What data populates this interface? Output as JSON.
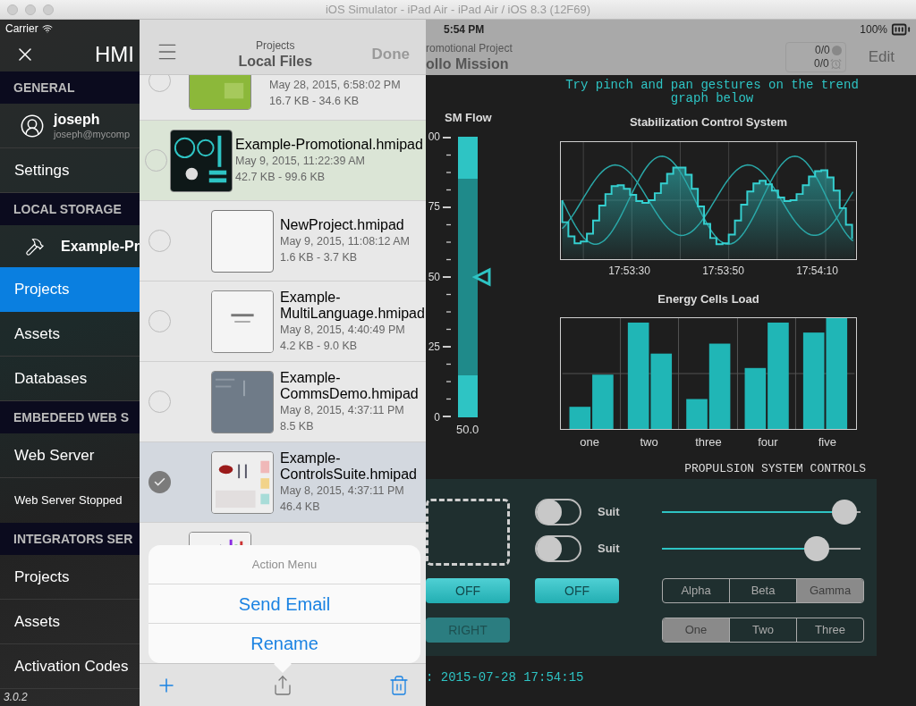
{
  "simulator": {
    "title": "iOS Simulator - iPad Air - iPad Air / iOS 8.3 (12F69)"
  },
  "status_bar": {
    "carrier": "Carrier",
    "time": "5:54 PM",
    "battery": "100%"
  },
  "sidebar": {
    "title": "HMI",
    "items": [
      {
        "kind": "section",
        "label": "GENERAL"
      },
      {
        "kind": "user",
        "name": "joseph",
        "email": "joseph@mycomp"
      },
      {
        "kind": "item",
        "label": "Settings",
        "selected": false
      },
      {
        "kind": "section",
        "label": "LOCAL STORAGE"
      },
      {
        "kind": "project",
        "label": "Example-Pr"
      },
      {
        "kind": "item",
        "label": "Projects",
        "selected": true
      },
      {
        "kind": "item",
        "label": "Assets",
        "selected": false
      },
      {
        "kind": "item",
        "label": "Databases",
        "selected": false
      },
      {
        "kind": "section",
        "label": "EMBEDEED WEB S"
      },
      {
        "kind": "item",
        "label": "Web Server",
        "selected": false
      },
      {
        "kind": "note",
        "label": "Web Server Stopped"
      },
      {
        "kind": "section",
        "label": "INTEGRATORS SER"
      },
      {
        "kind": "item",
        "label": "Projects",
        "selected": false
      },
      {
        "kind": "item",
        "label": "Assets",
        "selected": false
      },
      {
        "kind": "item",
        "label": "Activation Codes",
        "selected": false
      }
    ],
    "version": "3.0.2"
  },
  "file_browser": {
    "subtitle": "Projects",
    "title": "Local Files",
    "done": "Done",
    "files": [
      {
        "kind": "partial",
        "date": "May 28, 2015, 6:58:02 PM",
        "size": "16.7 KB - 34.6 KB",
        "checked": false,
        "current": false
      },
      {
        "kind": "file",
        "name": "Example-Promotional.hmipad",
        "date": "May 9, 2015, 11:22:39 AM",
        "size": "42.7 KB - 99.6 KB",
        "checked": false,
        "current": true
      },
      {
        "kind": "file",
        "name": "NewProject.hmipad",
        "date": "May 9, 2015, 11:08:12 AM",
        "size": "1.6 KB - 3.7 KB",
        "checked": false,
        "current": false
      },
      {
        "kind": "file",
        "name": "Example-\nMultiLanguage.hmipad",
        "date": "May 8, 2015, 4:40:49 PM",
        "size": "4.2 KB - 9.0 KB",
        "checked": false,
        "current": false
      },
      {
        "kind": "file",
        "name": "Example-\nCommsDemo.hmipad",
        "date": "May 8, 2015, 4:37:11 PM",
        "size": "8.5 KB",
        "checked": false,
        "current": false
      },
      {
        "kind": "file",
        "name": "Example-\nControlsSuite.hmipad",
        "date": "May 8, 2015, 4:37:11 PM",
        "size": "46.4 KB",
        "checked": true,
        "current": false
      },
      {
        "kind": "thumbnail_only"
      }
    ],
    "action_menu": {
      "title": "Action Menu",
      "actions": [
        "Send Email",
        "Rename"
      ]
    }
  },
  "dashboard": {
    "project_subtitle": "romotional Project",
    "project_title": "ollo Mission",
    "alarms": [
      "0/0",
      "0/0"
    ],
    "edit": "Edit",
    "hint": "Try pinch and pan gestures on the trend graph below",
    "gauge": {
      "title": "SM Flow",
      "ticks": [
        "00",
        "75",
        "50",
        "25",
        "0"
      ],
      "level": 0.5,
      "value": "50.0"
    },
    "trend": {
      "title": "Stabilization Control System",
      "time_labels": [
        "17:53:30",
        "17:53:50",
        "17:54:10"
      ]
    },
    "energy": {
      "title": "Energy Cells Load",
      "categories": [
        "one",
        "two",
        "three",
        "four",
        "five"
      ]
    },
    "controls": {
      "title": "PROPULSION SYSTEM CONTROLS",
      "buttons": [
        {
          "label": "OFF",
          "disabled": false
        },
        {
          "label": "RIGHT",
          "disabled": true
        },
        {
          "label": "OFF",
          "disabled": false
        }
      ],
      "switches": [
        {
          "label": "Suit",
          "on": false
        },
        {
          "label": "Suit",
          "on": false
        }
      ],
      "sliders": [
        {
          "level": 0.92
        },
        {
          "level": 0.78
        }
      ],
      "segments": [
        [
          {
            "label": "Alpha",
            "selected": false
          },
          {
            "label": "Beta",
            "selected": false
          },
          {
            "label": "Gamma",
            "selected": true
          }
        ],
        [
          {
            "label": "One",
            "selected": true
          },
          {
            "label": "Two",
            "selected": false
          },
          {
            "label": "Three",
            "selected": false
          }
        ]
      ]
    },
    "timestamp": ": 2015-07-28 17:54:15"
  }
}
